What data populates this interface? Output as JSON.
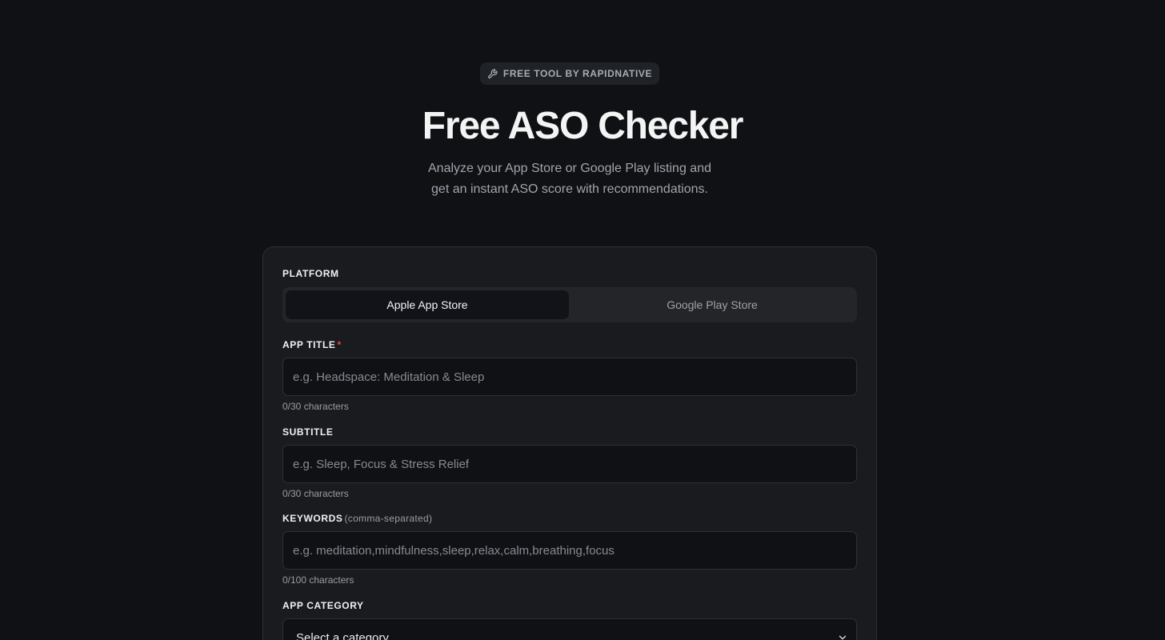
{
  "badge": {
    "icon": "wrench-icon",
    "label": "FREE TOOL BY RAPIDNATIVE"
  },
  "hero": {
    "title": "Free ASO Checker",
    "subtitle": "Analyze your App Store or Google Play listing and get an instant ASO score with recommendations."
  },
  "form": {
    "platform": {
      "label": "PLATFORM",
      "options": [
        "Apple App Store",
        "Google Play Store"
      ],
      "selected": "Apple App Store"
    },
    "app_title": {
      "label": "APP TITLE",
      "required_mark": "*",
      "placeholder": "e.g. Headspace: Meditation & Sleep",
      "value": "",
      "counter": "0/30 characters"
    },
    "subtitle": {
      "label": "SUBTITLE",
      "placeholder": "e.g. Sleep, Focus & Stress Relief",
      "value": "",
      "counter": "0/30 characters"
    },
    "keywords": {
      "label": "KEYWORDS",
      "hint": "(comma-separated)",
      "placeholder": "e.g. meditation,mindfulness,sleep,relax,calm,breathing,focus",
      "value": "",
      "counter": "0/100 characters"
    },
    "category": {
      "label": "APP CATEGORY",
      "selected": "Select a category",
      "icon": "chevron-down-icon"
    }
  },
  "colors": {
    "background": "#0f1115",
    "card": "#1a1b1e",
    "required": "#ef4444"
  }
}
